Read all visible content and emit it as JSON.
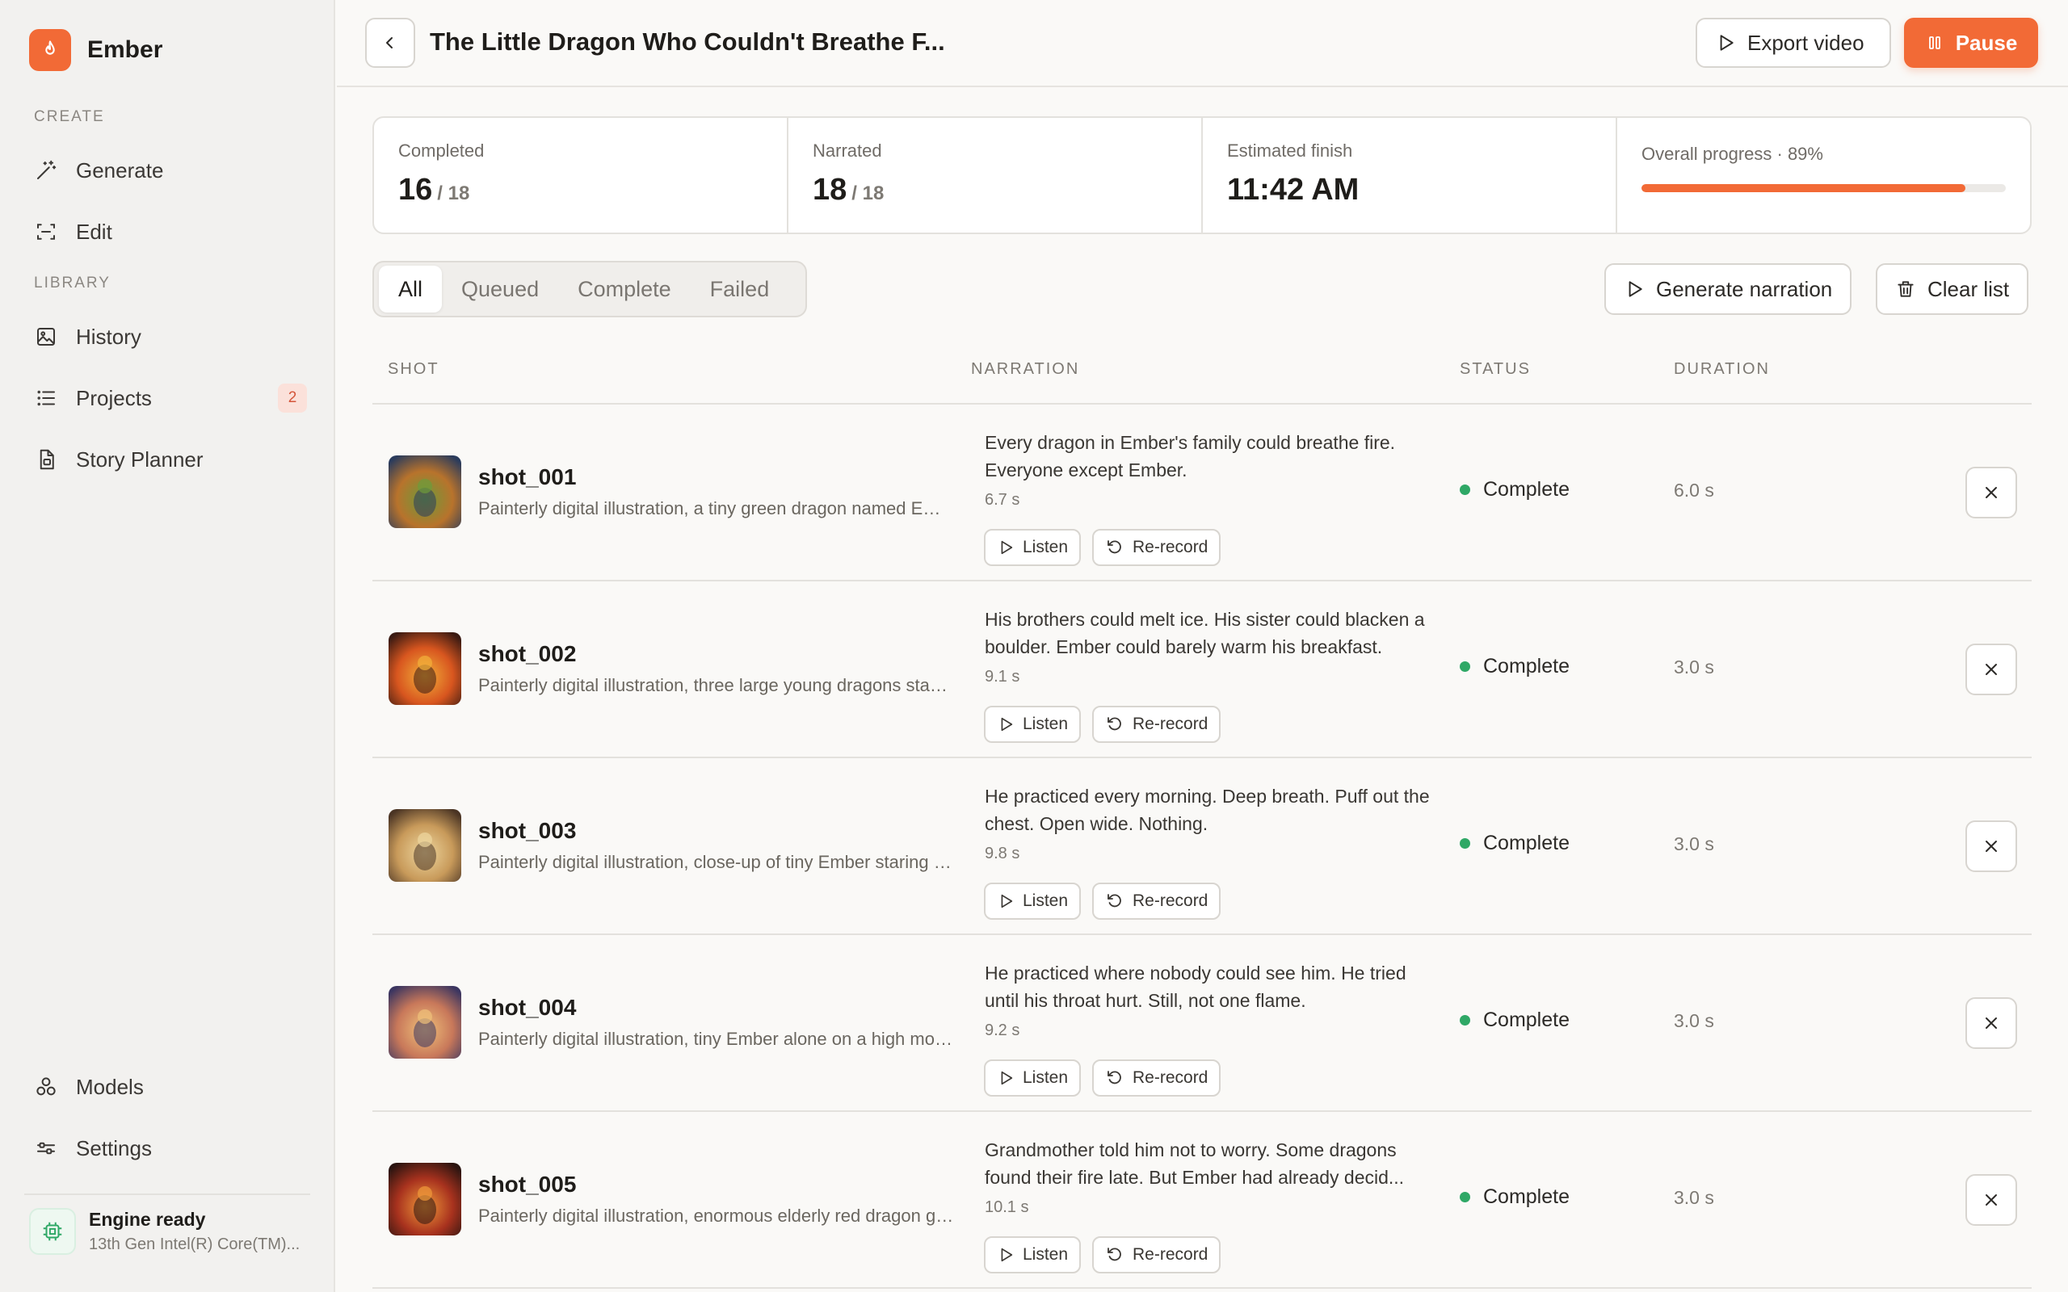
{
  "app": {
    "name": "Ember",
    "logo_icon": "flame-icon",
    "accent": "#f26a36"
  },
  "sidebar": {
    "create_label": "CREATE",
    "library_label": "LIBRARY",
    "create_items": [
      {
        "label": "Generate",
        "icon": "magic-wand-icon"
      },
      {
        "label": "Edit",
        "icon": "edit-frame-icon"
      }
    ],
    "library_items": [
      {
        "label": "History",
        "icon": "image-gallery-icon"
      },
      {
        "label": "Projects",
        "icon": "list-icon",
        "badge": "2"
      },
      {
        "label": "Story Planner",
        "icon": "document-icon"
      }
    ],
    "bottom_items": [
      {
        "label": "Models",
        "icon": "cubes-icon"
      },
      {
        "label": "Settings",
        "icon": "sliders-icon"
      }
    ],
    "engine": {
      "title": "Engine ready",
      "subtitle": "13th Gen Intel(R) Core(TM)..."
    }
  },
  "header": {
    "title": "The Little Dragon Who Couldn't Breathe F...",
    "export_label": "Export video",
    "pause_label": "Pause"
  },
  "stats": {
    "completed": {
      "label": "Completed",
      "value": "16",
      "of": "/ 18"
    },
    "narrated": {
      "label": "Narrated",
      "value": "18",
      "of": "/ 18"
    },
    "finish": {
      "label": "Estimated finish",
      "value": "11:42 AM"
    },
    "progress": {
      "label": "Overall progress · 89%",
      "percent": 89
    }
  },
  "filters": [
    "All",
    "Queued",
    "Complete",
    "Failed"
  ],
  "active_filter": "All",
  "actions": {
    "generate_narration": "Generate narration",
    "clear_list": "Clear list"
  },
  "table": {
    "columns": {
      "shot": "SHOT",
      "narration": "NARRATION",
      "status": "STATUS",
      "duration": "DURATION"
    },
    "listen_label": "Listen",
    "rerecord_label": "Re-record",
    "rows": [
      {
        "name": "shot_001",
        "description": "Painterly digital illustration, a tiny green dragon named Ember sitting alone",
        "narration": "Every dragon in Ember's family could breathe fire. Everyone except Ember.",
        "narration_duration": "6.7 s",
        "status": "Complete",
        "duration": "6.0 s",
        "thumb_colors": [
          "#2a3b5c",
          "#b8732c",
          "#6d9b3a"
        ]
      },
      {
        "name": "shot_002",
        "description": "Painterly digital illustration, three large young dragons standing in fire",
        "narration": "His brothers could melt ice. His sister could blacken a boulder. Ember could barely warm his breakfast.",
        "narration_duration": "9.1 s",
        "status": "Complete",
        "duration": "3.0 s",
        "thumb_colors": [
          "#3a1a12",
          "#d8561f",
          "#f2b13a"
        ]
      },
      {
        "name": "shot_003",
        "description": "Painterly digital illustration, close-up of tiny Ember staring at a bowl",
        "narration": "He practiced every morning. Deep breath. Puff out the chest. Open wide. Nothing.",
        "narration_duration": "9.8 s",
        "status": "Complete",
        "duration": "3.0 s",
        "thumb_colors": [
          "#4a3424",
          "#c89a5a",
          "#eed7a0"
        ]
      },
      {
        "name": "shot_004",
        "description": "Painterly digital illustration, tiny Ember alone on a high mountain ledge",
        "narration": "He practiced where nobody could see him. He tried until his throat hurt. Still, not one flame.",
        "narration_duration": "9.2 s",
        "status": "Complete",
        "duration": "3.0 s",
        "thumb_colors": [
          "#3b3560",
          "#c8785a",
          "#f0c27a"
        ]
      },
      {
        "name": "shot_005",
        "description": "Painterly digital illustration, enormous elderly red dragon grandmother",
        "narration": "Grandmother told him not to worry. Some dragons found their fire late. But Ember had already decid...",
        "narration_duration": "10.1 s",
        "status": "Complete",
        "duration": "3.0 s",
        "thumb_colors": [
          "#2a1410",
          "#a8321e",
          "#f09a3a"
        ]
      }
    ]
  }
}
